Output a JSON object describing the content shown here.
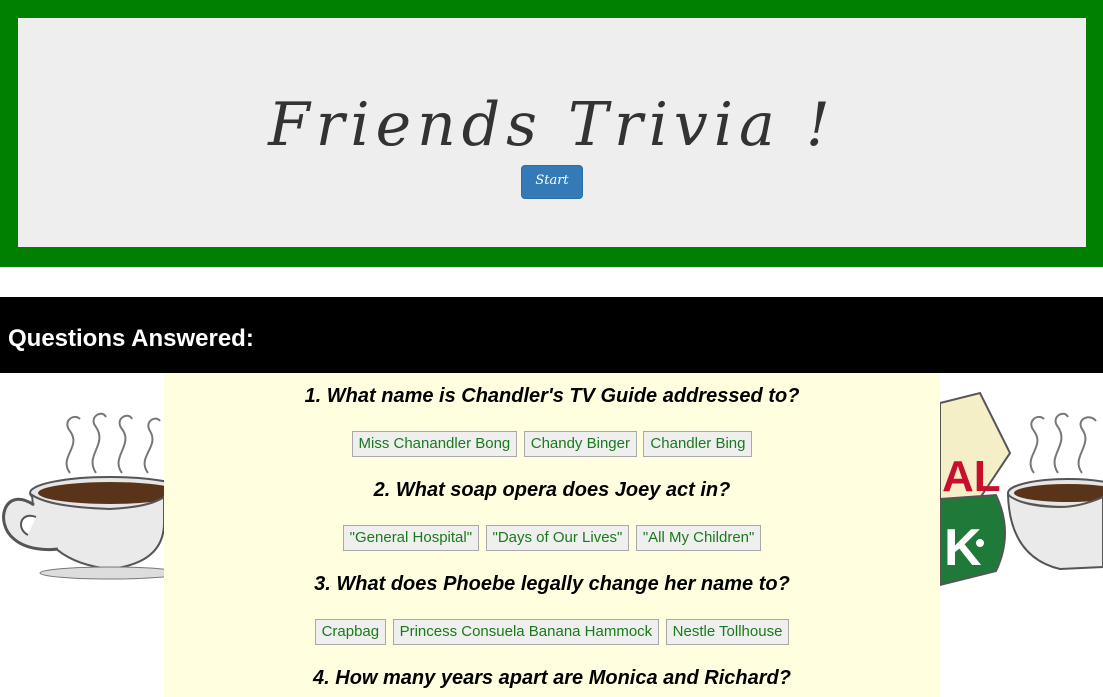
{
  "header": {
    "title": "Friends Trivia !",
    "start_label": "Start"
  },
  "answered": {
    "label": "Questions Answered:"
  },
  "questions": [
    {
      "text": "1. What name is Chandler's TV Guide addressed to?",
      "answers": [
        "Miss Chanandler Bong",
        "Chandy Binger",
        "Chandler Bing"
      ]
    },
    {
      "text": "2. What soap opera does Joey act in?",
      "answers": [
        "\"General Hospital\"",
        "\"Days of Our Lives\"",
        "\"All My Children\""
      ]
    },
    {
      "text": "3. What does Phoebe legally change her name to?",
      "answers": [
        "Crapbag",
        "Princess Consuela Banana Hammock",
        "Nestle Tollhouse"
      ]
    },
    {
      "text": "4. How many years apart are Monica and Richard?",
      "answers": []
    }
  ],
  "colors": {
    "header_border": "#008000",
    "header_bg": "#eeeeee",
    "start_button": "#337ab7",
    "answered_bar": "#000000",
    "panel_bg": "#ffffe0",
    "answer_text": "#1a7a1a"
  }
}
